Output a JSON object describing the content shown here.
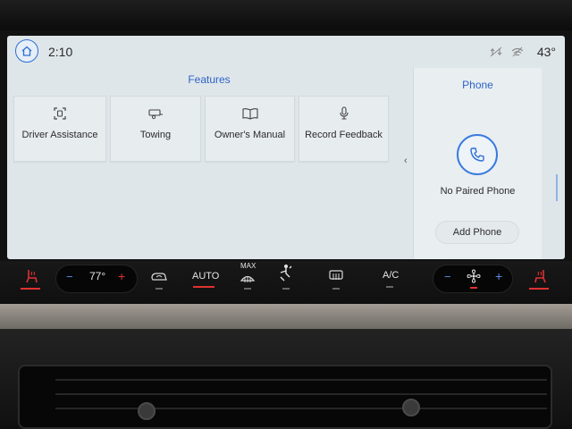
{
  "status_bar": {
    "time": "2:10",
    "outside_temp": "43°",
    "icons": [
      "home-icon",
      "sync-off-icon",
      "wifi-off-icon"
    ]
  },
  "features": {
    "title": "Features",
    "tiles": [
      {
        "label": "Driver Assistance",
        "icon": "driver-assist-icon"
      },
      {
        "label": "Towing",
        "icon": "trailer-icon"
      },
      {
        "label": "Owner's Manual",
        "icon": "book-icon"
      },
      {
        "label": "Record Feedback",
        "icon": "microphone-icon"
      }
    ]
  },
  "phone": {
    "title": "Phone",
    "status": "No Paired Phone",
    "add_button": "Add Phone"
  },
  "climate": {
    "driver_temp": "77°",
    "auto_label": "AUTO",
    "max_label": "MAX",
    "ac_label": "A/C",
    "decrease_symbol": "−",
    "increase_symbol": "+"
  },
  "colors": {
    "accent": "#2d63c8",
    "screen_bg": "#dfe6ea",
    "indicator_red": "#e03232"
  }
}
